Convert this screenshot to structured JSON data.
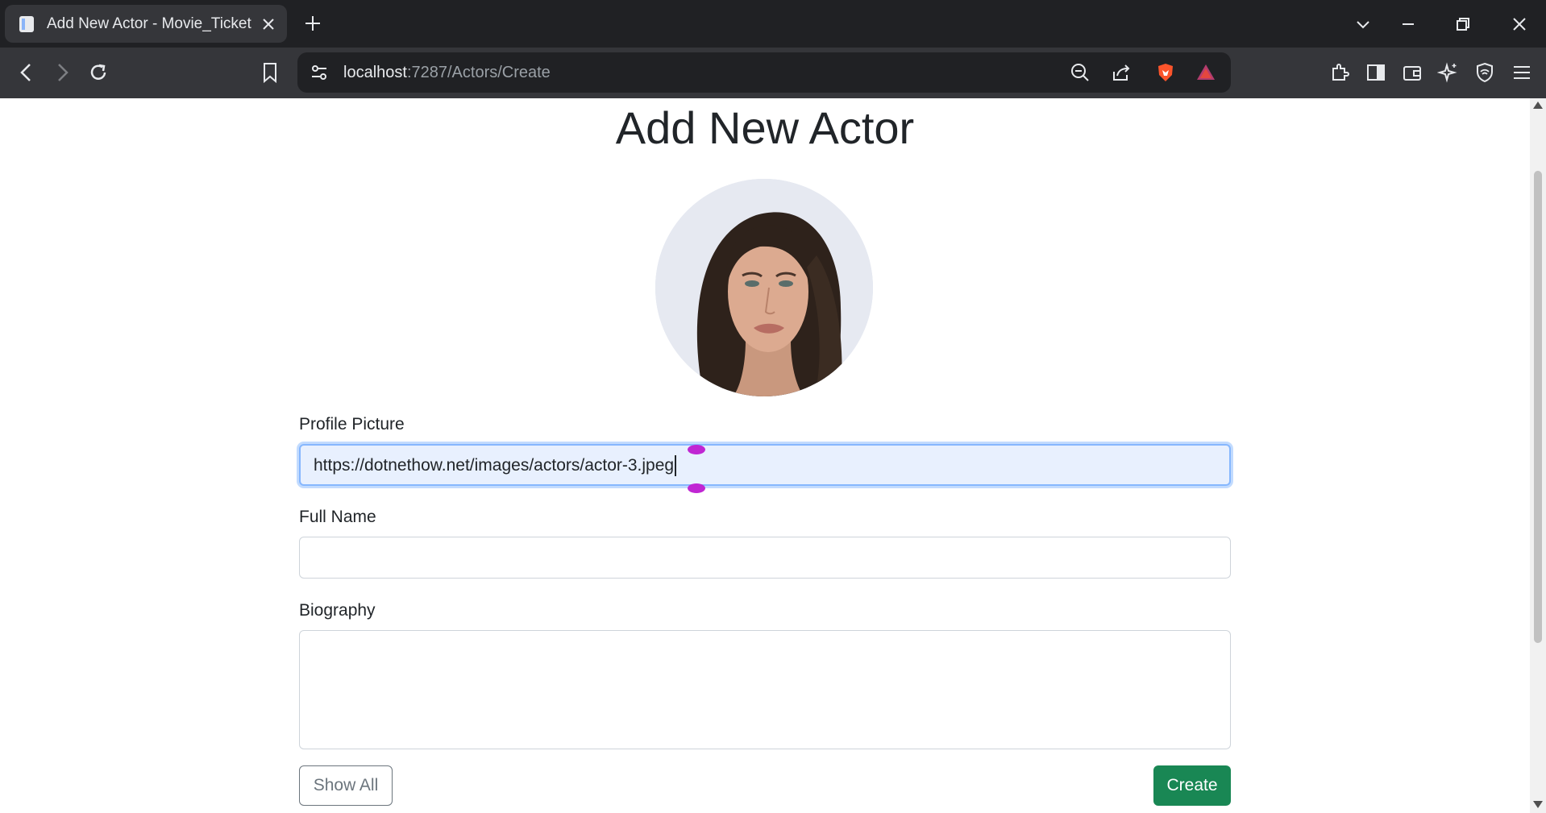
{
  "browser": {
    "tab_title": "Add New Actor - Movie_Ticket",
    "url_host": "localhost",
    "url_path": ":7287/Actors/Create"
  },
  "page": {
    "title": "Add New Actor",
    "avatar_alt": "Actor profile picture"
  },
  "form": {
    "profile_picture_label": "Profile Picture",
    "profile_picture_value": "https://dotnethow.net/images/actors/actor-3.jpeg",
    "full_name_label": "Full Name",
    "full_name_value": "",
    "biography_label": "Biography",
    "biography_value": "",
    "show_all_label": "Show All",
    "create_label": "Create"
  },
  "colors": {
    "create_button": "#198754",
    "focus_border": "#86b7fe",
    "selection_handle": "#c026d3"
  }
}
